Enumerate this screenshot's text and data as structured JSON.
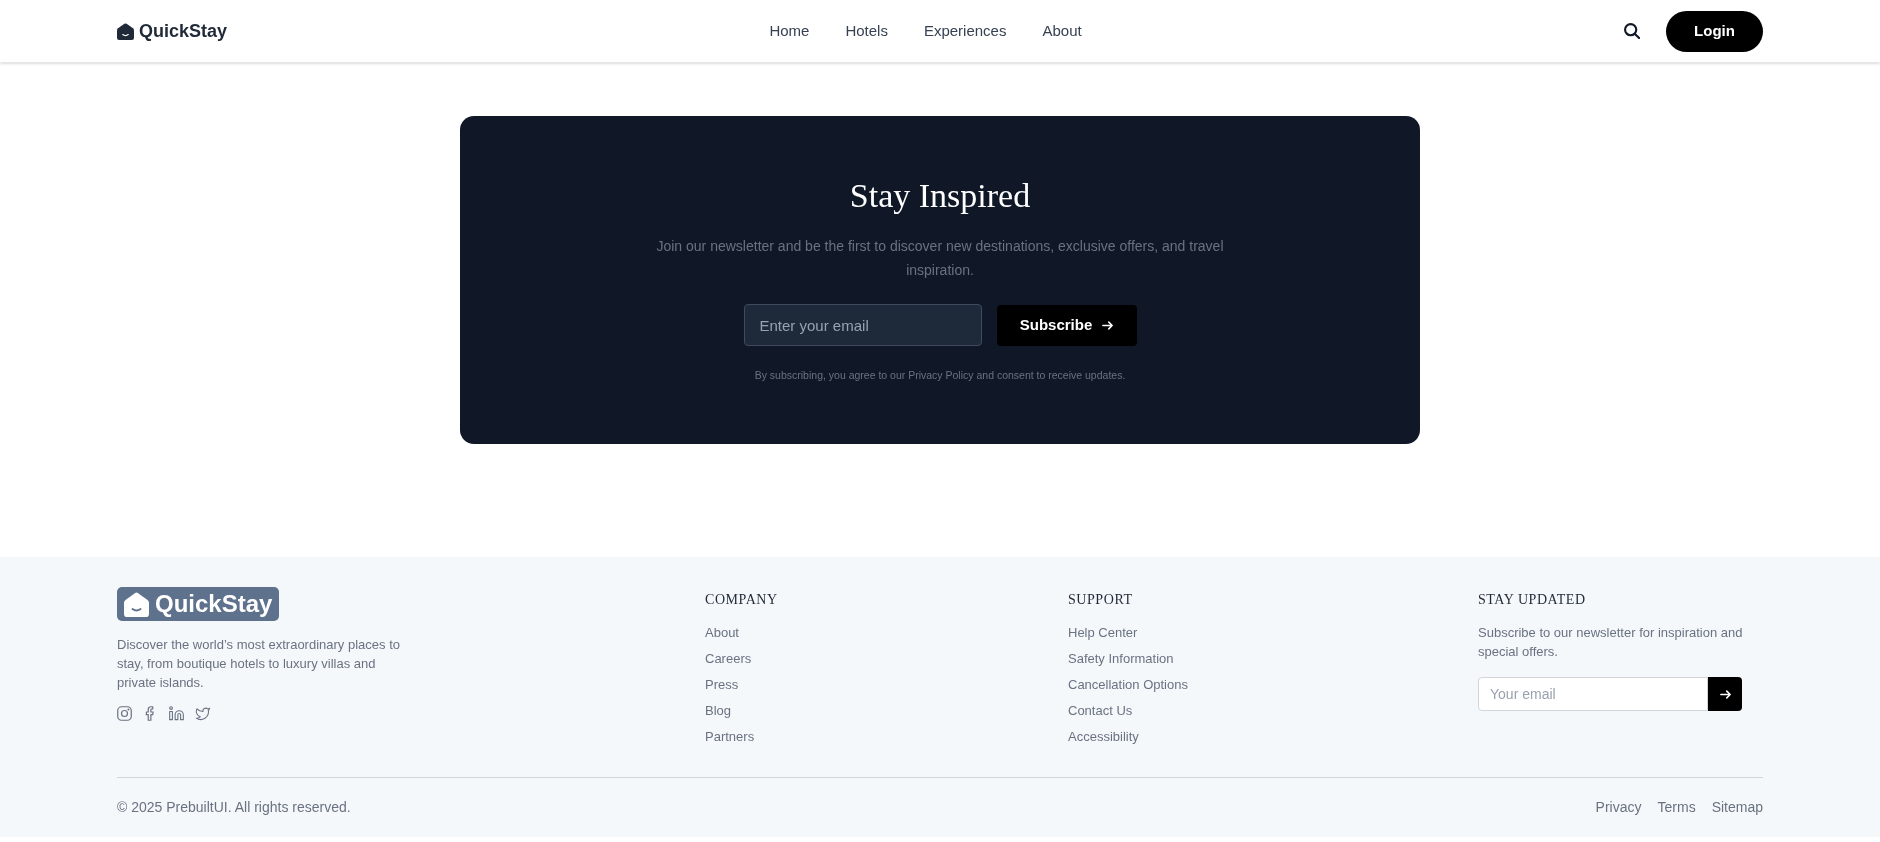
{
  "nav": {
    "logo": "QuickStay",
    "links": [
      "Home",
      "Hotels",
      "Experiences",
      "About"
    ],
    "login_button": "Login"
  },
  "newsletter": {
    "title": "Stay Inspired",
    "description": "Join our newsletter and be the first to discover new destinations, exclusive offers, and travel inspiration.",
    "email_placeholder": "Enter your email",
    "subscribe_button": "Subscribe",
    "disclaimer": "By subscribing, you agree to our Privacy Policy and consent to receive updates."
  },
  "footer": {
    "logo": "QuickStay",
    "description": "Discover the world’s most extraordinary places to stay, from boutique hotels to luxury villas and private islands.",
    "columns": [
      {
        "heading": "COMPANY",
        "links": [
          "About",
          "Careers",
          "Press",
          "Blog",
          "Partners"
        ]
      },
      {
        "heading": "SUPPORT",
        "links": [
          "Help Center",
          "Safety Information",
          "Cancellation Options",
          "Contact Us",
          "Accessibility"
        ]
      }
    ],
    "stay_updated": {
      "heading": "STAY UPDATED",
      "text": "Subscribe to our newsletter for inspiration and special offers.",
      "email_placeholder": "Your email"
    },
    "copyright": "© 2025 PrebuiltUI. All rights reserved.",
    "legal_links": [
      "Privacy",
      "Terms",
      "Sitemap"
    ]
  }
}
